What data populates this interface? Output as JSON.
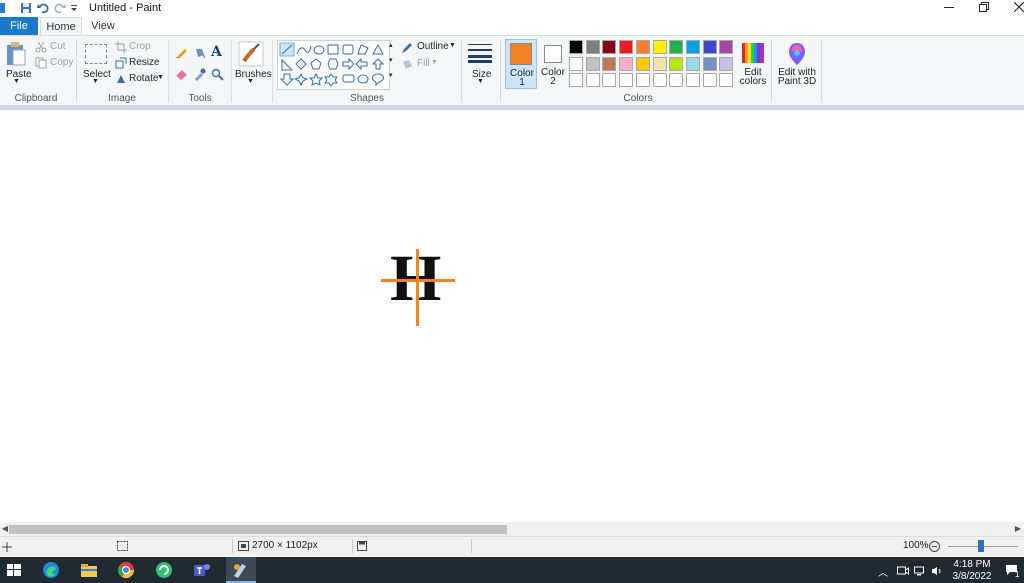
{
  "window": {
    "title": "Untitled - Paint",
    "quick_access": [
      "save-icon",
      "undo-icon",
      "redo-icon",
      "customize-arrow-icon"
    ],
    "controls": [
      "minimize-icon",
      "restore-icon",
      "close-icon"
    ]
  },
  "tabs": {
    "file": "File",
    "home": "Home",
    "view": "View"
  },
  "ribbon": {
    "clipboard": {
      "paste": "Paste",
      "cut": "Cut",
      "copy": "Copy",
      "group": "Clipboard"
    },
    "image": {
      "select": "Select",
      "crop": "Crop",
      "resize": "Resize",
      "rotate": "Rotate",
      "group": "Image"
    },
    "tools": {
      "group": "Tools",
      "items": [
        "pencil-icon",
        "fill-icon",
        "text-icon",
        "eraser-icon",
        "color-picker-icon",
        "magnifier-icon"
      ]
    },
    "brushes": {
      "label": "Brushes"
    },
    "shapes": {
      "group": "Shapes",
      "outline": "Outline",
      "fill": "Fill"
    },
    "size": {
      "label": "Size"
    },
    "color1": {
      "label": "Color 1",
      "color": "#f58220"
    },
    "color2": {
      "label": "Color 2",
      "color": "#ffffff"
    },
    "colors": {
      "group": "Colors",
      "palette_row1": [
        "#000000",
        "#7f7f7f",
        "#880015",
        "#ed1c24",
        "#ff7f27",
        "#fff200",
        "#22b14c",
        "#00a2e8",
        "#3f48cc",
        "#a349a4"
      ],
      "palette_row2": [
        "#ffffff",
        "#c3c3c3",
        "#b97a57",
        "#ffaec9",
        "#ffc90e",
        "#efe4b0",
        "#b5e61d",
        "#99d9ea",
        "#7092be",
        "#c8bfe7"
      ],
      "palette_row3": [
        "#ffffff",
        "#ffffff",
        "#ffffff",
        "#ffffff",
        "#ffffff",
        "#ffffff",
        "#ffffff",
        "#ffffff",
        "#ffffff",
        "#ffffff"
      ]
    },
    "edit_colors": "Edit colors",
    "edit_with_paint3d": "Edit with Paint 3D"
  },
  "canvas": {
    "glyph": "H",
    "cursor": "crosshair-cursor",
    "cursor_color": "#f58220"
  },
  "status": {
    "dimensions": "2700 × 1102px",
    "zoom": "100%"
  },
  "taskbar": {
    "apps": [
      "start-icon",
      "edge-icon",
      "file-explorer-icon",
      "chrome-icon",
      "app-icon",
      "teams-icon",
      "paint-icon"
    ],
    "time": "4:18 PM",
    "date": "3/8/2022",
    "notification_count": "1"
  }
}
